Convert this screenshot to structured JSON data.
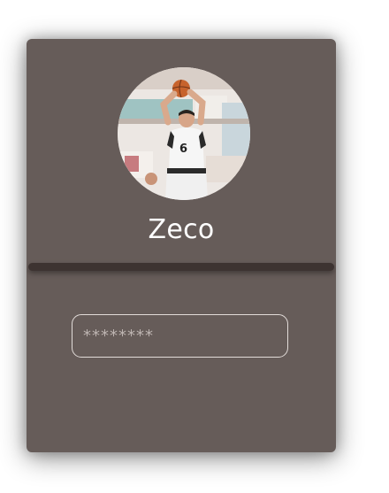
{
  "login": {
    "username": "Zeco",
    "password_placeholder": "********"
  },
  "colors": {
    "card_background": "#665c59",
    "divider": "#3d3331",
    "input_border": "#e2dcd9",
    "text": "#ffffff"
  },
  "icons": {
    "avatar": "basketball-player-photo"
  }
}
